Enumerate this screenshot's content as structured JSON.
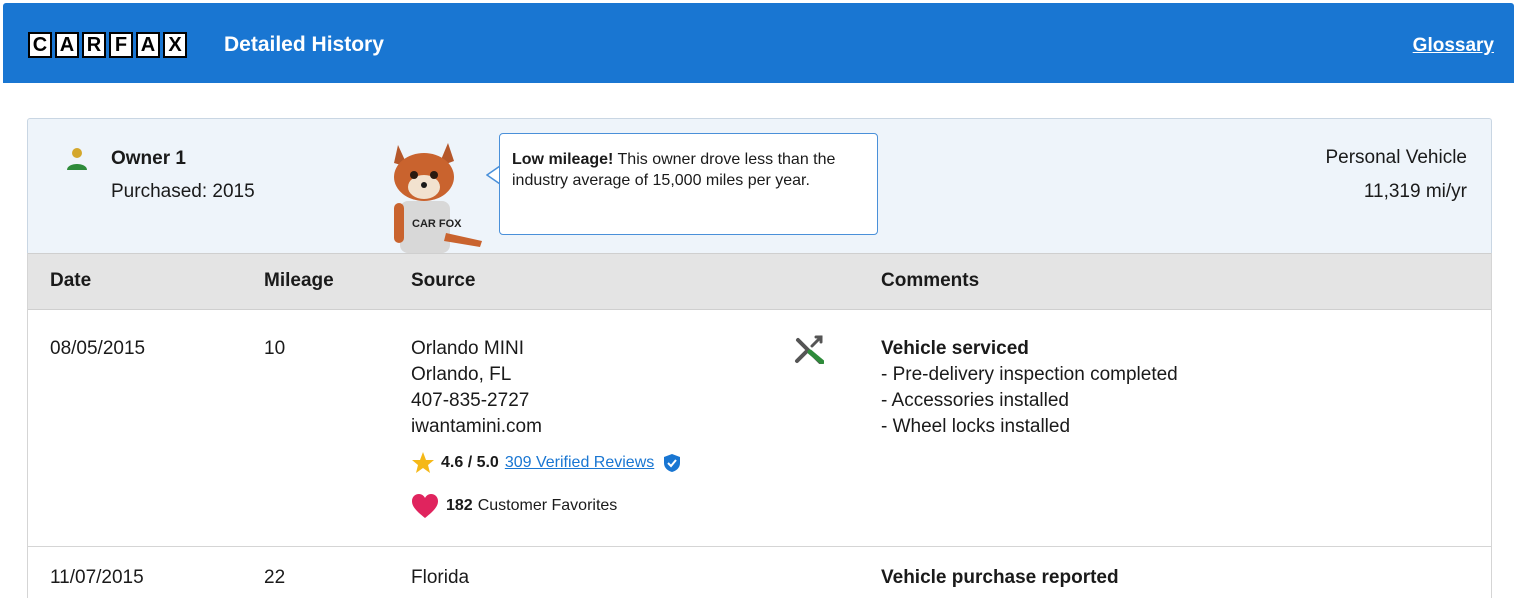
{
  "header": {
    "logo_letters": [
      "C",
      "A",
      "R",
      "F",
      "A",
      "X"
    ],
    "title": "Detailed History",
    "glossary_label": "Glossary",
    "background_color": "#1976d2"
  },
  "owner": {
    "name": "Owner 1",
    "purchased": "Purchased: 2015",
    "tip_bold": "Low mileage!",
    "tip_text": " This owner drove less than the industry average of 15,000 miles per year.",
    "vehicle_type": "Personal Vehicle",
    "miles_per_year": "11,319 mi/yr",
    "mascot_shirt": "CAR FOX"
  },
  "table": {
    "headers": [
      "Date",
      "Mileage",
      "Source",
      "Comments"
    ],
    "rows": [
      {
        "date": "08/05/2015",
        "mileage": "10",
        "source": [
          "Orlando MINI",
          "Orlando, FL",
          "407-835-2727",
          "iwantamini.com"
        ],
        "rating": "4.6 / 5.0",
        "reviews": "309 Verified Reviews",
        "favorites_count": "182",
        "favorites_label": "Customer Favorites",
        "comment_title": "Vehicle serviced",
        "comment_items": [
          "- Pre-delivery inspection completed",
          "- Accessories installed",
          "- Wheel locks installed"
        ],
        "icon": "service-tools-icon"
      },
      {
        "date": "11/07/2015",
        "mileage": "22",
        "source": [
          "Florida"
        ],
        "comment_title": "Vehicle purchase reported"
      }
    ]
  }
}
